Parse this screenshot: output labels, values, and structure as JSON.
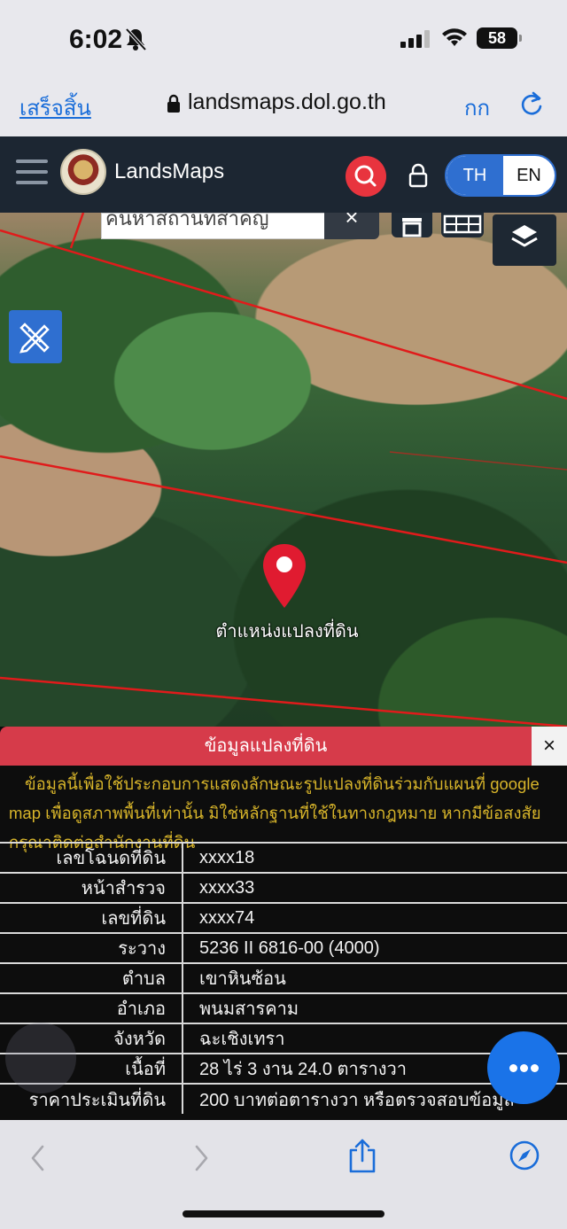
{
  "status_bar": {
    "time": "6:02",
    "battery": "58"
  },
  "browser": {
    "done_label": "เสร็จสิ้น",
    "url": "landsmaps.dol.go.th",
    "font_size_label": "กก"
  },
  "app_header": {
    "brand": "LandsMaps",
    "lang_th": "TH",
    "lang_en": "EN"
  },
  "map": {
    "search_placeholder": "ค้นหาสถานที่สำคัญ",
    "clear_label": "×",
    "pin_label": "ตำแหน่งแปลงที่ดิน"
  },
  "panel": {
    "title": "ข้อมูลแปลงที่ดิน",
    "close_label": "×",
    "disclaimer": "ข้อมูลนี้เพื่อใช้ประกอบการแสดงลักษณะรูปแปลงที่ดินร่วมกับแผนที่ google map เพื่อดูสภาพพื้นที่เท่านั้น มิใช่หลักฐานที่ใช้ในทางกฎหมาย หากมีข้อสงสัย กรุณาติดต่อสำนักงานที่ดิน",
    "rows": [
      {
        "label": "เลขโฉนดที่ดิน",
        "value": "xxxx18"
      },
      {
        "label": "หน้าสำรวจ",
        "value": "xxxx33"
      },
      {
        "label": "เลขที่ดิน",
        "value": "xxxx74"
      },
      {
        "label": "ระวาง",
        "value": "5236 II 6816-00 (4000)"
      },
      {
        "label": "ตำบล",
        "value": "เขาหินซ้อน"
      },
      {
        "label": "อำเภอ",
        "value": "พนมสารคาม"
      },
      {
        "label": "จังหวัด",
        "value": "ฉะเชิงเทรา"
      },
      {
        "label": "เนื้อที่",
        "value": "28 ไร่ 3 งาน 24.0 ตารางวา"
      },
      {
        "label": "ราคาประเมินที่ดิน",
        "value": "200 บาทต่อตารางวา หรือตรวจสอบข้อมูล"
      }
    ]
  },
  "icons": {
    "bell": "bell-slash-icon",
    "signal": "cellular-signal-icon",
    "wifi": "wifi-icon",
    "lock": "lock-icon",
    "reload": "reload-icon",
    "menu": "hamburger-menu-icon",
    "search": "search-icon",
    "padlock": "padlock-icon",
    "layers": "layers-icon",
    "draw": "ruler-pencil-icon",
    "home": "building-icon",
    "grid": "grid-icon",
    "pin": "map-pin-icon",
    "more": "more-dots-icon",
    "back": "chevron-left-icon",
    "forward": "chevron-right-icon",
    "share": "share-icon",
    "compass": "compass-icon"
  },
  "colors": {
    "header_bg": "#1c2632",
    "accent_blue": "#2f6fd0",
    "search_red": "#e8343e",
    "panel_header_red": "#d63b4a",
    "disclaimer_yellow": "#d8b52a",
    "parcel_line_red": "#e01b1b"
  }
}
